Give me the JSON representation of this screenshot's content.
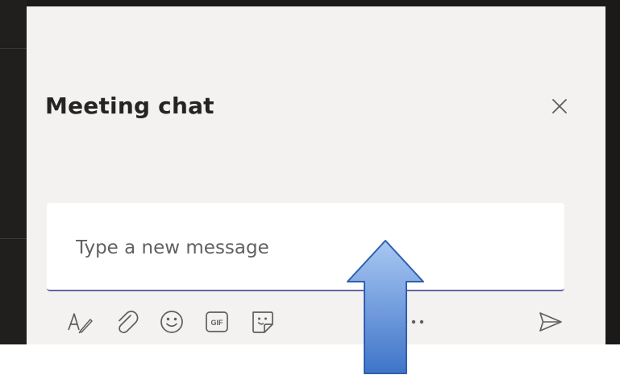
{
  "chat": {
    "title": "Meeting chat",
    "compose": {
      "placeholder": "Type a new message"
    }
  },
  "icons": {
    "close": "close-icon",
    "format": "format-icon",
    "attach": "attach-icon",
    "emoji": "emoji-icon",
    "gif": "gif-icon",
    "sticker": "sticker-icon",
    "more": "more-options-icon",
    "send": "send-icon"
  },
  "colors": {
    "panel_background": "#f3f2f1",
    "frame_dark": "#1b1a19",
    "text_primary": "#252423",
    "placeholder": "#616161",
    "focus_underline": "#6264a7",
    "icon": "#605e5c",
    "arrow_light": "#a9c8f2",
    "arrow_dark": "#3f74c9"
  }
}
